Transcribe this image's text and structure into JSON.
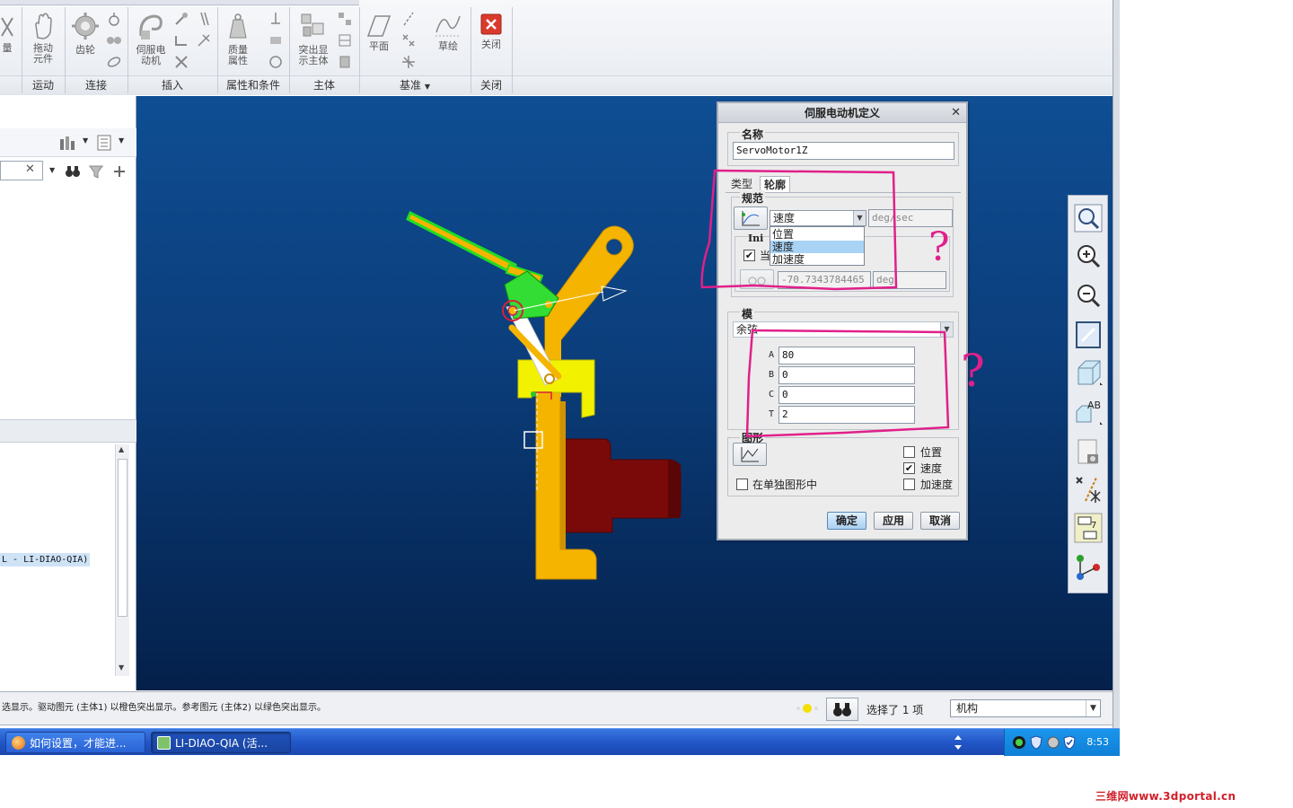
{
  "ribbon": {
    "buttons": [
      {
        "label": "量"
      },
      {
        "label": "拖动\n元件"
      },
      {
        "label": "齿轮"
      },
      {
        "label": "伺服电\n动机"
      },
      {
        "label": "质量\n属性"
      },
      {
        "label": "突出显\n示主体"
      },
      {
        "label": "平面"
      },
      {
        "label": "草绘"
      },
      {
        "label": "关闭"
      }
    ],
    "groups": [
      "运动",
      "连接",
      "插入",
      "属性和条件",
      "主体",
      "基准",
      "关闭"
    ]
  },
  "left_panel": {
    "tree_item": "L - LI-DIAO-QIA)"
  },
  "dialog": {
    "title": "伺服电动机定义",
    "name_label": "名称",
    "name_value": "ServoMotor1Z",
    "tabs": [
      "类型",
      "轮廓"
    ],
    "spec_label": "规范",
    "spec_selected": "速度",
    "spec_unit": "deg/sec",
    "spec_options": [
      "位置",
      "速度",
      "加速度"
    ],
    "initial_label": "Ini",
    "current_check_label": "当",
    "initial_value": "-70.7343784465",
    "initial_unit": "deg",
    "model_label": "模",
    "model_selected": "余弦",
    "params": [
      {
        "name": "A",
        "value": "80"
      },
      {
        "name": "B",
        "value": "0"
      },
      {
        "name": "C",
        "value": "0"
      },
      {
        "name": "T",
        "value": "2"
      }
    ],
    "graph_label": "图形",
    "graph_options": [
      {
        "label": "位置",
        "checked": false
      },
      {
        "label": "速度",
        "checked": true
      },
      {
        "label": "加速度",
        "checked": false
      }
    ],
    "separate_graph_label": "在单独图形中",
    "ok": "确定",
    "apply": "应用",
    "cancel": "取消"
  },
  "annotations": {
    "question_marks": [
      "?",
      "?"
    ],
    "color": "#e0208a"
  },
  "statusbar": {
    "message": "选显示。驱动图元 (主体1) 以橙色突出显示。参考图元 (主体2) 以绿色突出显示。",
    "selection": "选择了 1 项",
    "filter": "机构"
  },
  "taskbar": {
    "tasks": [
      "如何设置，才能进...",
      "LI-DIAO-QIA (活..."
    ],
    "clock": "8:53"
  },
  "watermark": "三维网www.3dportal.cn",
  "colors": {
    "viewport_top": "#0f4e93",
    "viewport_bottom": "#04204a",
    "orange_part": "#f5b400",
    "yellow_part": "#f2f200",
    "darkred_part": "#7a0a0a",
    "green_highlight": "#22dd22",
    "annotation": "#e0208a"
  }
}
